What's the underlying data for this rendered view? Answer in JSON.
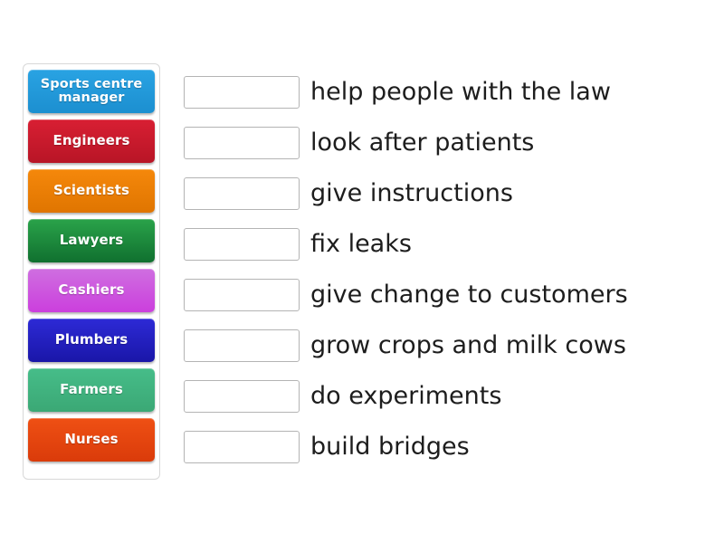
{
  "activity": {
    "type": "match-up",
    "tile_panel": {
      "tiles": [
        {
          "label": "Sports centre manager",
          "color": "#29a3e3",
          "color_bottom": "#1c8fd0"
        },
        {
          "label": "Engineers",
          "color": "#d81f33",
          "color_bottom": "#b81526"
        },
        {
          "label": "Scientists",
          "color": "#f5880b",
          "color_bottom": "#e07500"
        },
        {
          "label": "Lawyers",
          "color": "#2aa34a",
          "color_bottom": "#10702f"
        },
        {
          "label": "Cashiers",
          "color": "#cf6fe0",
          "color_bottom": "#cb3fdd"
        },
        {
          "label": "Plumbers",
          "color": "#2d2ad6",
          "color_bottom": "#1a16a8"
        },
        {
          "label": "Farmers",
          "color": "#46bd89",
          "color_bottom": "#3ba875"
        },
        {
          "label": "Nurses",
          "color": "#ef5014",
          "color_bottom": "#da3b0a"
        }
      ]
    },
    "rows": [
      {
        "dropzone_value": "",
        "answer": "help people with the law"
      },
      {
        "dropzone_value": "",
        "answer": "look after patients"
      },
      {
        "dropzone_value": "",
        "answer": "give instructions"
      },
      {
        "dropzone_value": "",
        "answer": "fix leaks"
      },
      {
        "dropzone_value": "",
        "answer": "give change to customers"
      },
      {
        "dropzone_value": "",
        "answer": "grow crops and milk cows"
      },
      {
        "dropzone_value": "",
        "answer": "do experiments"
      },
      {
        "dropzone_value": "",
        "answer": "build bridges"
      }
    ],
    "colors": {
      "background": "#ffffff",
      "panel_border": "#d8d8d8",
      "dropzone_border": "#b4b4b4",
      "answer_text": "#1d1d1d",
      "tile_text": "#ffffff"
    }
  }
}
